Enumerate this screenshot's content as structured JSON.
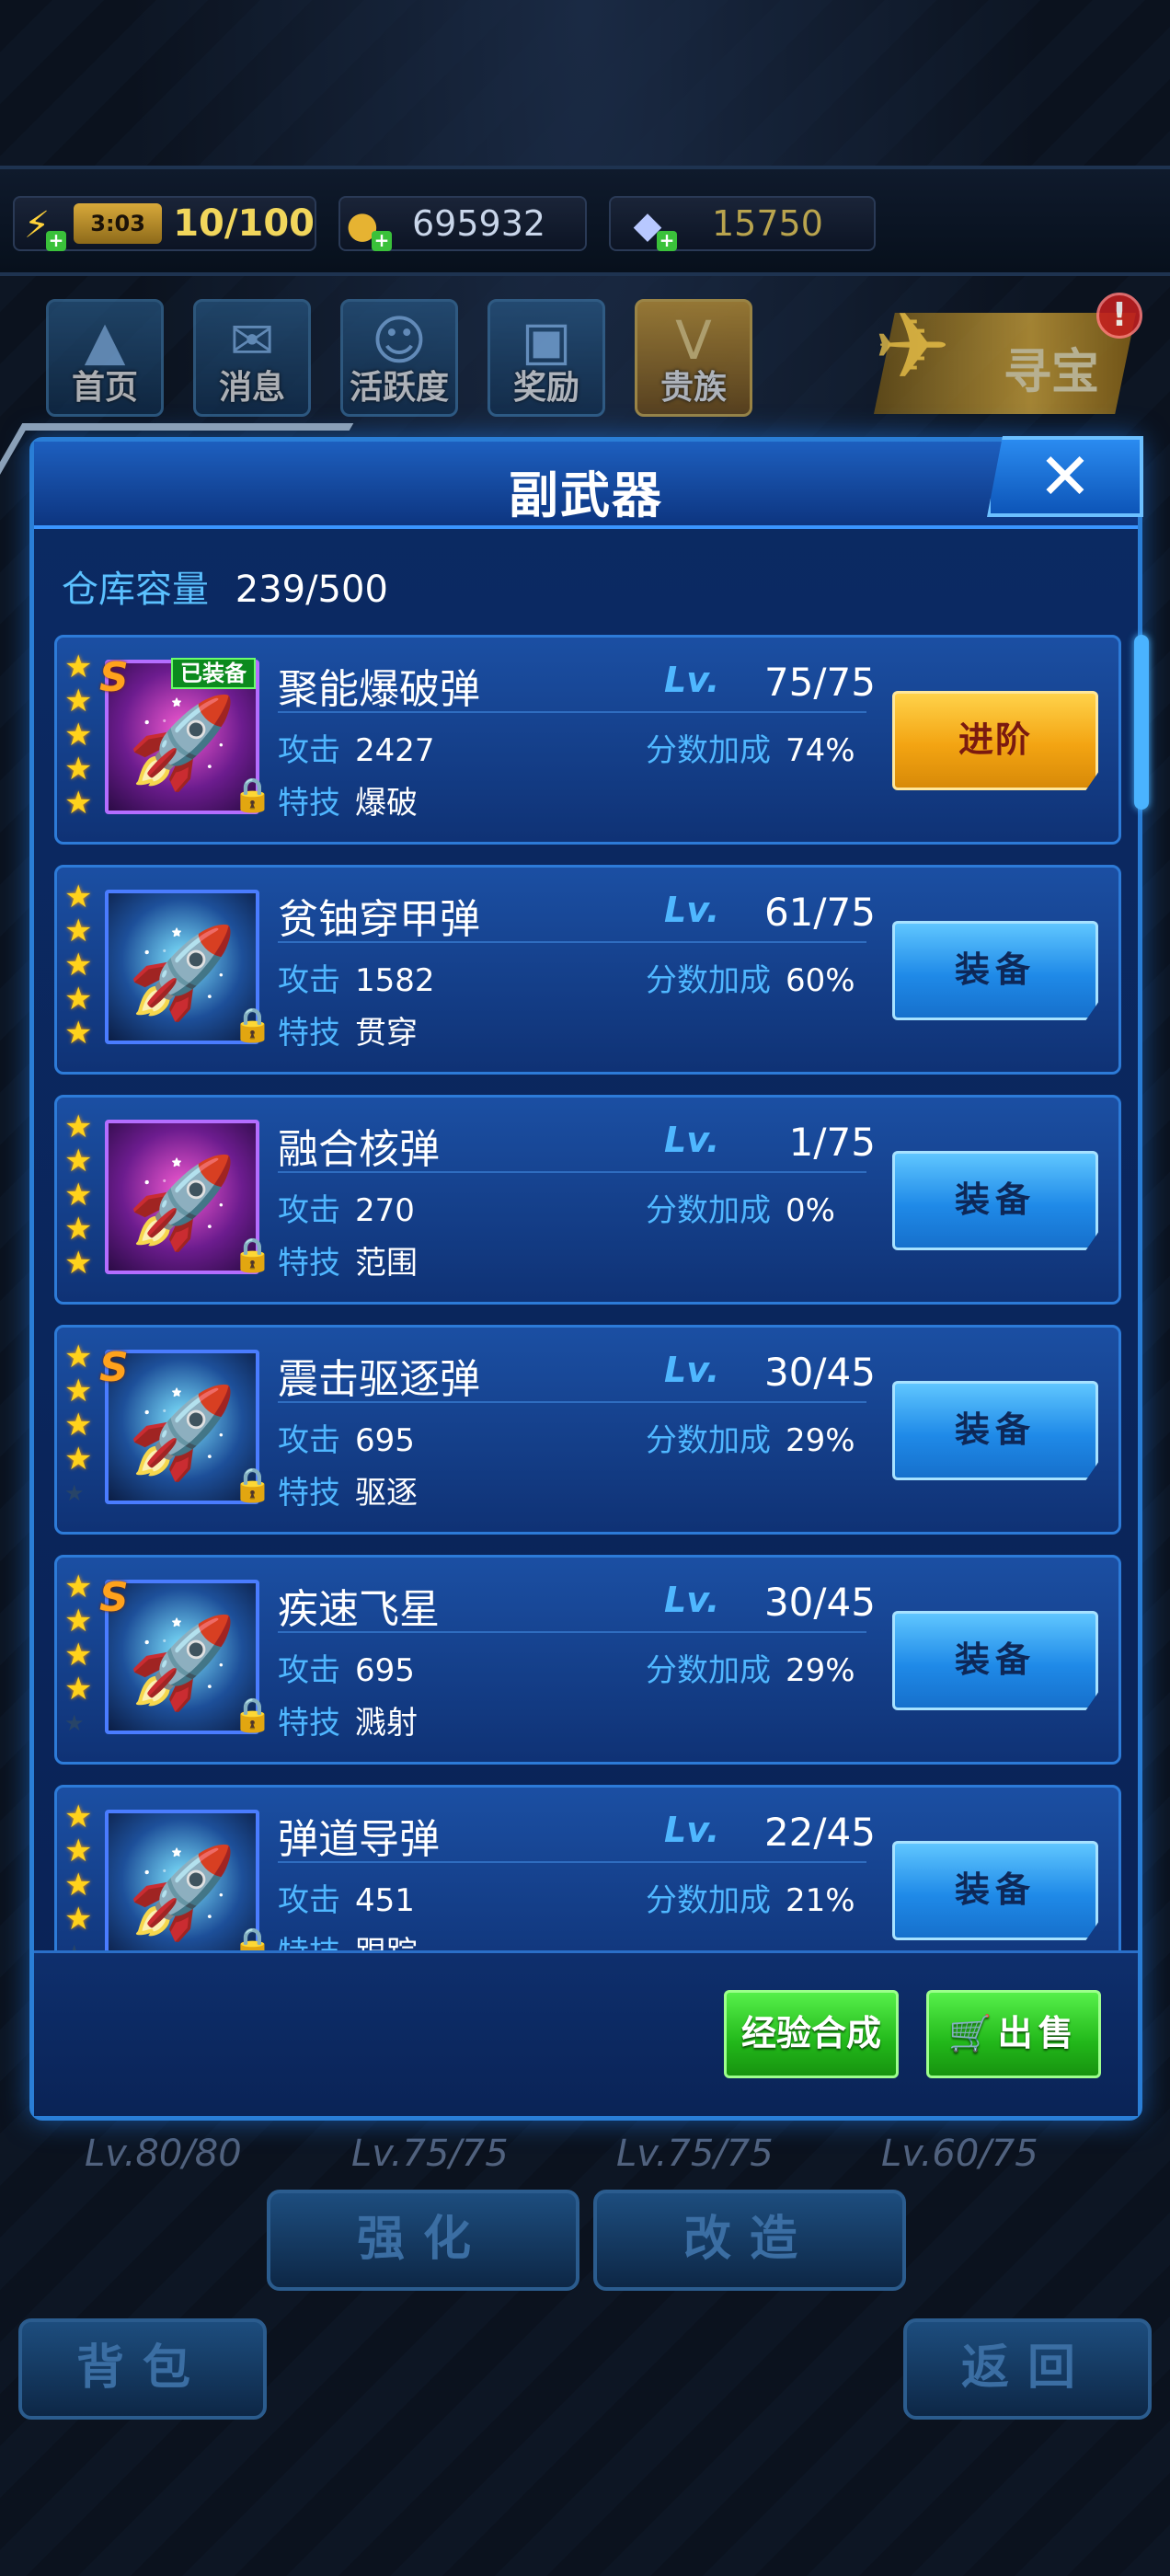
{
  "resources": {
    "energy_timer": "3:03",
    "energy": "10/100",
    "gold": "695932",
    "gems": "15750"
  },
  "nav": [
    {
      "label": "首页",
      "icon": "home-icon"
    },
    {
      "label": "消息",
      "icon": "message-icon"
    },
    {
      "label": "活跃度",
      "icon": "activity-icon"
    },
    {
      "label": "奖励",
      "icon": "reward-icon"
    },
    {
      "label": "贵族",
      "icon": "vip-icon"
    }
  ],
  "treasure": {
    "label": "寻宝",
    "alert": "!"
  },
  "panel": {
    "title": "副武器",
    "close": "✕",
    "capacity_label": "仓库容量",
    "capacity_value": "239/500",
    "exp_button": "经验合成",
    "sell_button": "出售"
  },
  "labels": {
    "lv": "Lv.",
    "attack": "攻击",
    "bonus": "分数加成",
    "skill": "特技",
    "equipped": "已装备"
  },
  "items": [
    {
      "name": "聚能爆破弹",
      "level": "75/75",
      "attack": "2427",
      "bonus": "74%",
      "skill": "爆破",
      "stars": 5,
      "rank": "S",
      "equipped": true,
      "button": "进阶"
    },
    {
      "name": "贫铀穿甲弹",
      "level": "61/75",
      "attack": "1582",
      "bonus": "60%",
      "skill": "贯穿",
      "stars": 5,
      "rank": "",
      "equipped": false,
      "button": "装备"
    },
    {
      "name": "融合核弹",
      "level": "1/75",
      "attack": "270",
      "bonus": "0%",
      "skill": "范围",
      "stars": 5,
      "rank": "",
      "equipped": false,
      "button": "装备"
    },
    {
      "name": "震击驱逐弹",
      "level": "30/45",
      "attack": "695",
      "bonus": "29%",
      "skill": "驱逐",
      "stars": 4,
      "rank": "S",
      "equipped": false,
      "button": "装备"
    },
    {
      "name": "疾速飞星",
      "level": "30/45",
      "attack": "695",
      "bonus": "29%",
      "skill": "溅射",
      "stars": 4,
      "rank": "S",
      "equipped": false,
      "button": "装备"
    },
    {
      "name": "弹道导弹",
      "level": "22/45",
      "attack": "451",
      "bonus": "21%",
      "skill": "跟踪",
      "stars": 4,
      "rank": "",
      "equipped": false,
      "button": "装备"
    }
  ],
  "background": {
    "levels": [
      "Lv.80/80",
      "Lv.75/75",
      "Lv.75/75",
      "Lv.60/75"
    ],
    "strengthen": "强化",
    "modify": "改造",
    "bag": "背包",
    "back": "返回"
  },
  "colors": {
    "accent_blue": "#4fb7ff",
    "star_gold": "#ffd21c",
    "advance_gold": "#f3a412",
    "equip_blue": "#1f8ae8",
    "green_button": "#22b81a"
  }
}
